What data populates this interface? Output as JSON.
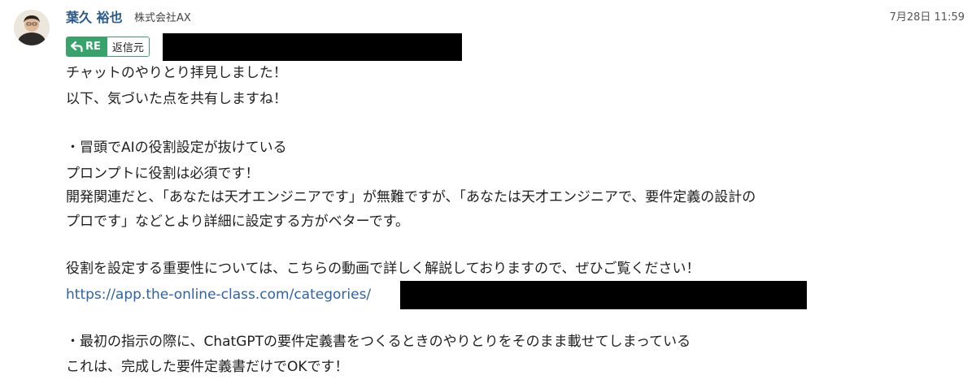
{
  "message": {
    "sender": {
      "name": "葉久 裕也",
      "company": "株式会社AX"
    },
    "timestamp": "7月28日 11:59",
    "reply_badge": {
      "tag": "RE",
      "label": "返信元"
    },
    "body": [
      "チャットのやりとり拝見しました！",
      "以下、気づいた点を共有しますね！",
      "・冒頭でAIの役割設定が抜けている",
      "プロンプトに役割は必須です！",
      "開発関連だと、「あなたは天才エンジニアです」が無難ですが、「あなたは天才エンジニアで、要件定義の設計の",
      "プロです」などとより詳細に設定する方がベターです。",
      "役割を設定する重要性については、こちらの動画で詳しく解説しておりますので、ぜひご覧ください！",
      "https://app.the-online-class.com/categories/",
      "・最初の指示の際に、ChatGPTの要件定義書をつくるときのやりとりをそのまま載せてしまっている",
      "これは、完成した要件定義書だけでOKです！"
    ]
  },
  "colors": {
    "accent_green": "#39a36c",
    "name_blue": "#2a5b8c",
    "link_blue": "#2e62a8"
  },
  "icons": {
    "avatar": "avatar-photo",
    "reply": "reply-arrow-icon"
  }
}
